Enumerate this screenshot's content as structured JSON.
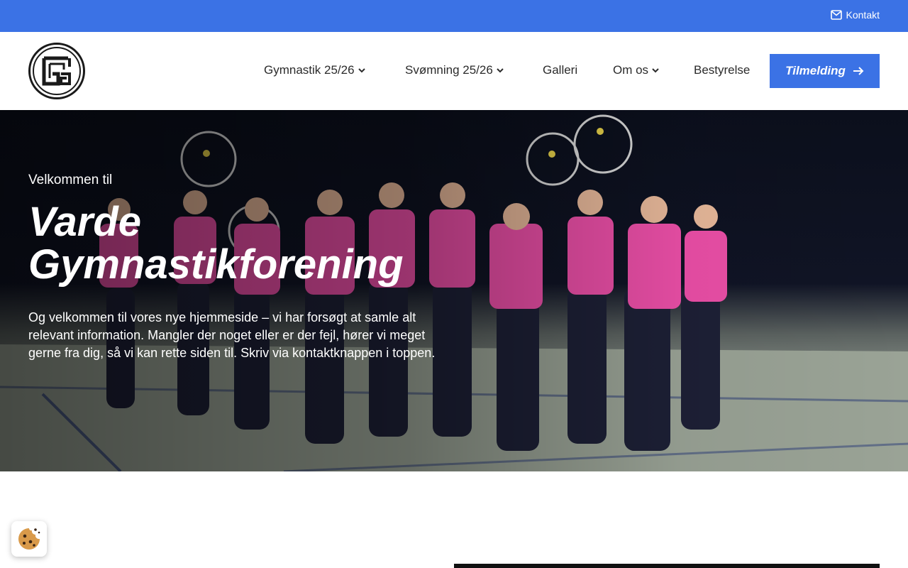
{
  "topbar": {
    "contact_label": "Kontakt",
    "contact_icon": "envelope-icon",
    "color": "#3b72e5"
  },
  "header": {
    "logo": "club-logo",
    "nav": [
      {
        "label": "Gymnastik 25/26",
        "has_dropdown": true
      },
      {
        "label": "Svømning 25/26",
        "has_dropdown": true
      },
      {
        "label": "Galleri",
        "has_dropdown": false
      },
      {
        "label": "Om os",
        "has_dropdown": true
      },
      {
        "label": "Bestyrelse",
        "has_dropdown": false
      }
    ],
    "cta_label": "Tilmelding",
    "cta_icon": "arrow-right-icon"
  },
  "hero": {
    "pretitle": "Velkommen til",
    "title_line1": "Varde",
    "title_line2": "Gymnastikforening",
    "text": "Og velkommen til vores nye hjemmeside – vi har forsøgt at samle alt relevant information. Mangler der noget eller er der fejl, hører vi meget gerne fra dig, så vi kan rette siden til. Skriv via kontaktknappen i toppen.",
    "image": "gymnasts-performing-photo"
  },
  "cookie": {
    "icon": "cookie-icon"
  },
  "colors": {
    "accent": "#3b72e5",
    "gymnast_top": "#ec4fa8"
  }
}
